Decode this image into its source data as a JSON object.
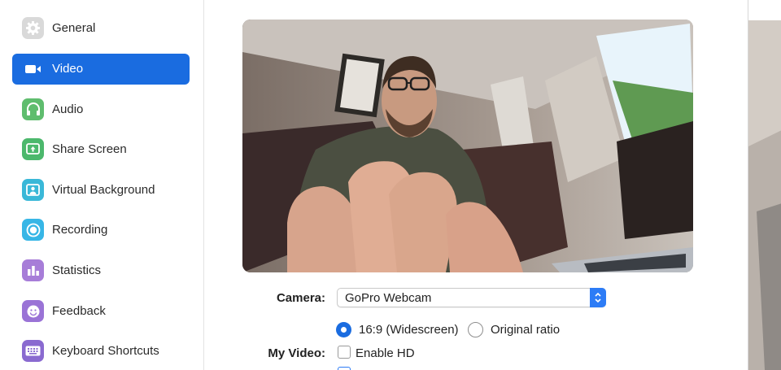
{
  "sidebar": {
    "items": [
      {
        "label": "General",
        "icon": "gear-icon",
        "color": "#d9d9d9",
        "active": false
      },
      {
        "label": "Video",
        "icon": "video-camera-icon",
        "color": "#1a6ce0",
        "active": true
      },
      {
        "label": "Audio",
        "icon": "headphones-icon",
        "color": "#5fbd6e",
        "active": false
      },
      {
        "label": "Share Screen",
        "icon": "share-screen-icon",
        "color": "#4cb86c",
        "active": false
      },
      {
        "label": "Virtual Background",
        "icon": "person-background-icon",
        "color": "#3ab8d8",
        "active": false
      },
      {
        "label": "Recording",
        "icon": "record-icon",
        "color": "#37b6e6",
        "active": false
      },
      {
        "label": "Statistics",
        "icon": "bar-chart-icon",
        "color": "#a77dd8",
        "active": false
      },
      {
        "label": "Feedback",
        "icon": "smiley-icon",
        "color": "#9a73d6",
        "active": false
      },
      {
        "label": "Keyboard Shortcuts",
        "icon": "keyboard-icon",
        "color": "#8a6ad0",
        "active": false
      }
    ]
  },
  "video": {
    "camera_label": "Camera:",
    "camera_value": "GoPro Webcam",
    "ratio_widescreen": "16:9 (Widescreen)",
    "ratio_original": "Original ratio",
    "ratio_selected": "16:9 (Widescreen)",
    "my_video_label": "My Video:",
    "enable_hd": "Enable HD",
    "enable_hd_checked": false
  },
  "colors": {
    "accent": "#1a6ce0",
    "stepper": "#2d7cf6"
  }
}
